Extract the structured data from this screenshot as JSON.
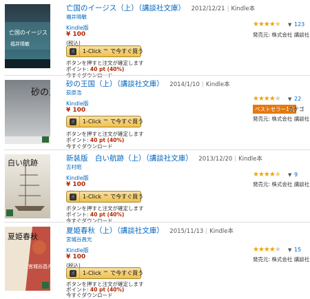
{
  "common": {
    "format": "Kindle版",
    "price": "¥ 100",
    "tax": "(税込)",
    "buy_button": "1-Click ™ で今すぐ買う",
    "note1": "ボタンを押すと注文が確定します",
    "points_prefix": "ポイント: ",
    "points_value": "40 pt (40%)",
    "note3": "今すぐダウンロード",
    "publisher_label": "発売元: 株式会社 講談社",
    "kindle_label": "Kindle本"
  },
  "items": [
    {
      "title": "亡国のイージス（上）（講談社文庫）",
      "date": "2012/12/21",
      "author": "福井晴敏",
      "rating": 4.5,
      "review_count": "123",
      "cover_colors": {
        "top": "#1e2b36",
        "bottom": "#2d5e6e",
        "band": "#122"
      },
      "cover_text": "亡国のイージス",
      "cover_sub": "福井晴敏"
    },
    {
      "title": "砂の王国（上）（講談社文庫）",
      "date": "2014/1/10",
      "author": "荻原浩",
      "rating": 4.0,
      "review_count": "22",
      "badge": "ベストセラー1位",
      "badge_after": "カテゴ",
      "cover_colors": {
        "top": "#8a8f95",
        "bottom": "#c9cbcc",
        "band": "#2d6b3a"
      },
      "cover_text": "砂の王国"
    },
    {
      "title": "新装版　白い航跡（上）（講談社文庫）",
      "date": "2013/12/20",
      "author": "吉村昭",
      "rating": 4.5,
      "review_count": "9",
      "cover_colors": {
        "top": "#e9e6de",
        "bottom": "#cfc9bb",
        "band": "#2d6b3a"
      },
      "cover_text": "白い航跡"
    },
    {
      "title": "夏姫春秋（上）（講談社文庫）",
      "date": "2015/11/13",
      "author": "宮城谷昌光",
      "rating": 4.0,
      "review_count": "15",
      "cover_colors": {
        "top": "#e8d9c4",
        "bottom": "#b8362a",
        "band": "#2d6b3a"
      },
      "cover_text": "夏姫春秋",
      "cover_sub": "宮城谷昌光"
    }
  ]
}
